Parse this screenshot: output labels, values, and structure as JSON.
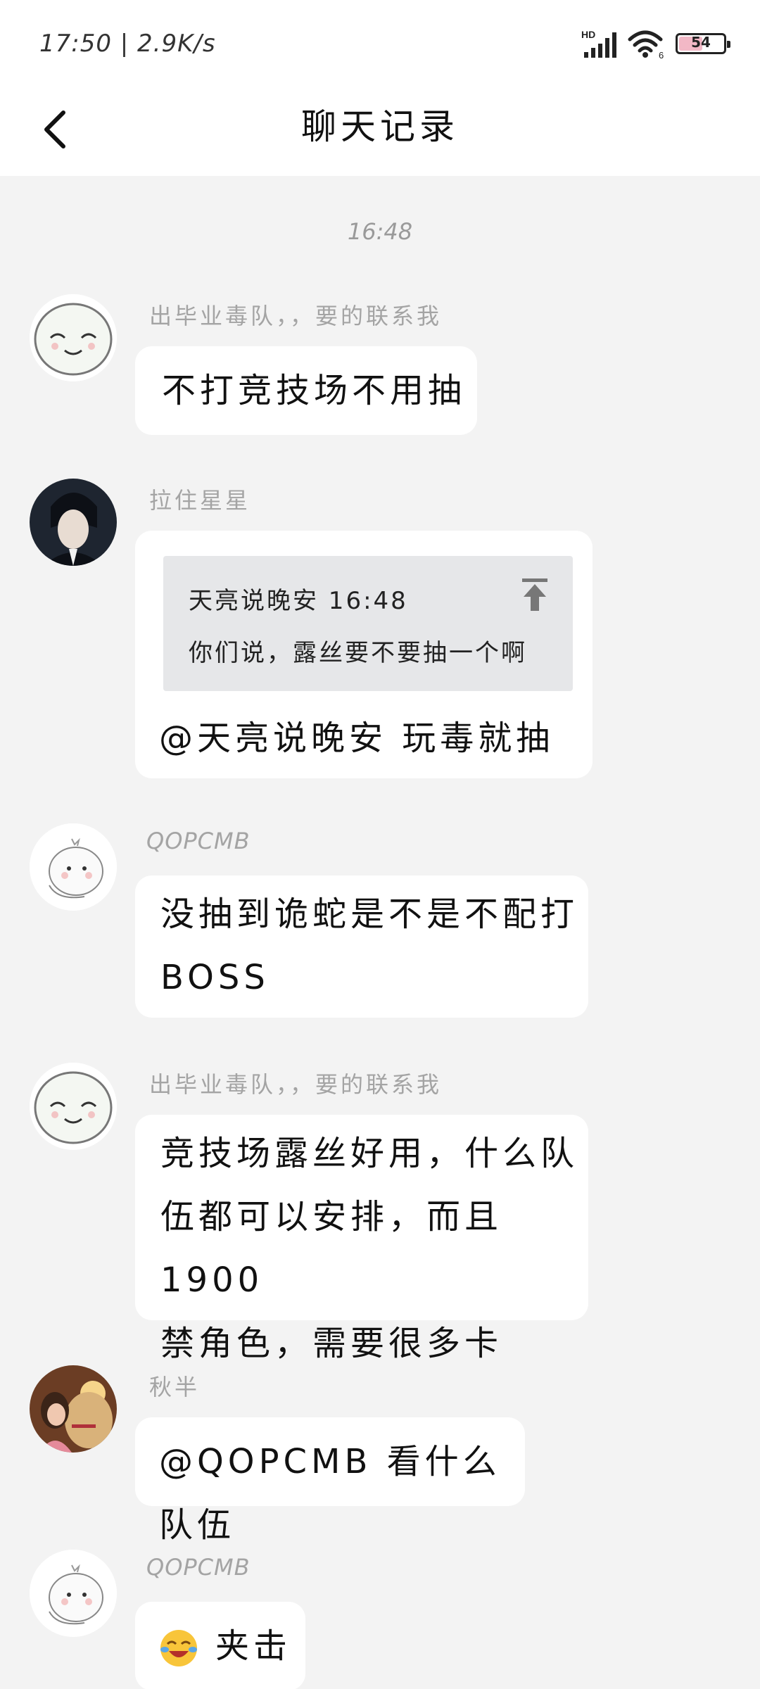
{
  "status_bar": {
    "time": "17:50 | 2.9K/s",
    "network_label": "HD",
    "wifi_label": "6",
    "battery": "54"
  },
  "header": {
    "title": "聊天记录"
  },
  "timestamp": "16:48",
  "messages": [
    {
      "sender": "出毕业毒队，，要的联系我",
      "text": "不打竞技场不用抽"
    },
    {
      "sender": "拉住星星",
      "quote_head": "天亮说晚安 16:48",
      "quote_body": "你们说，露丝要不要抽一个啊",
      "text": "@天亮说晚安 玩毒就抽"
    },
    {
      "sender": "QOPCMB",
      "line1": "没抽到诡蛇是不是不配打",
      "line2": "BOSS"
    },
    {
      "sender": "出毕业毒队，，要的联系我",
      "line1": "竞技场露丝好用，什么队",
      "line2": "伍都可以安排，而且1900",
      "line3": "禁角色，需要很多卡"
    },
    {
      "sender": "秋半",
      "text": "@QOPCMB 看什么队伍"
    },
    {
      "sender": "QOPCMB",
      "emoji": "laughing-crying-emoji",
      "text": "夹击"
    }
  ]
}
